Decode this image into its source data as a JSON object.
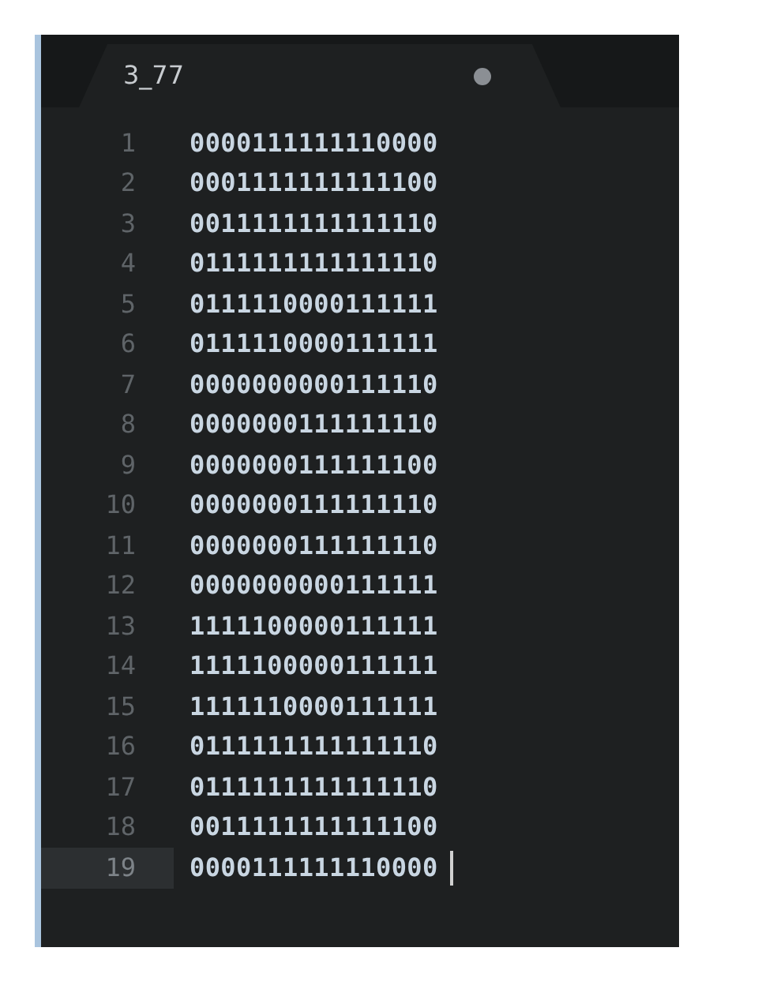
{
  "tab": {
    "title": "3_77",
    "modified": true,
    "selected": true
  },
  "lines": [
    {
      "number": "1",
      "text": "0000111111110000",
      "selected": false
    },
    {
      "number": "2",
      "text": "0001111111111100",
      "selected": false
    },
    {
      "number": "3",
      "text": "0011111111111110",
      "selected": false
    },
    {
      "number": "4",
      "text": "0111111111111110",
      "selected": false
    },
    {
      "number": "5",
      "text": "0111110000111111",
      "selected": false
    },
    {
      "number": "6",
      "text": "0111110000111111",
      "selected": false
    },
    {
      "number": "7",
      "text": "0000000000111110",
      "selected": false
    },
    {
      "number": "8",
      "text": "0000000111111110",
      "selected": false
    },
    {
      "number": "9",
      "text": "0000000111111100",
      "selected": false
    },
    {
      "number": "10",
      "text": "0000000111111110",
      "selected": false
    },
    {
      "number": "11",
      "text": "0000000111111110",
      "selected": false
    },
    {
      "number": "12",
      "text": "0000000000111111",
      "selected": false
    },
    {
      "number": "13",
      "text": "1111100000111111",
      "selected": false
    },
    {
      "number": "14",
      "text": "1111100000111111",
      "selected": false
    },
    {
      "number": "15",
      "text": "1111110000111111",
      "selected": false
    },
    {
      "number": "16",
      "text": "0111111111111110",
      "selected": false
    },
    {
      "number": "17",
      "text": "0111111111111110",
      "selected": false
    },
    {
      "number": "18",
      "text": "0011111111111100",
      "selected": false
    },
    {
      "number": "19",
      "text": "0000111111110000",
      "selected": true
    }
  ]
}
